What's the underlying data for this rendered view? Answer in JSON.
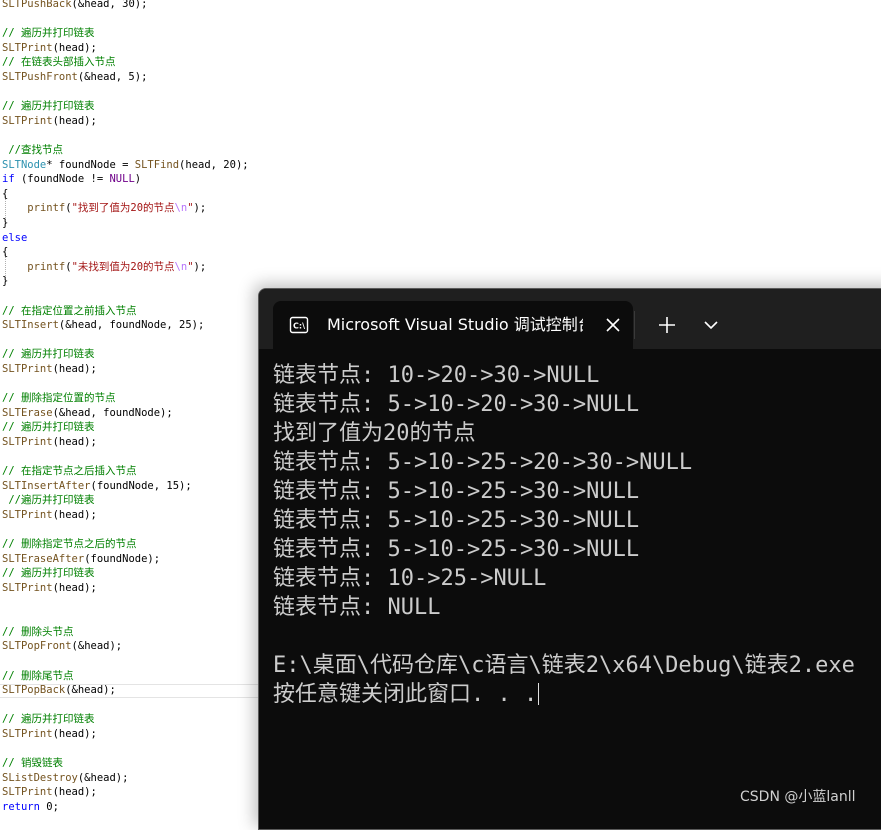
{
  "editor": {
    "lines": [
      [
        [
          "tok-func",
          "SLTPushBack"
        ],
        [
          "",
          "(&head, 30);"
        ]
      ],
      [],
      [
        [
          "tok-comment",
          "// 遍历并打印链表"
        ]
      ],
      [
        [
          "tok-func",
          "SLTPrint"
        ],
        [
          "",
          "(head);"
        ]
      ],
      [
        [
          "tok-comment",
          "// 在链表头部插入节点"
        ]
      ],
      [
        [
          "tok-func",
          "SLTPushFront"
        ],
        [
          "",
          "(&head, 5);"
        ]
      ],
      [],
      [
        [
          "tok-comment",
          "// 遍历并打印链表"
        ]
      ],
      [
        [
          "tok-func",
          "SLTPrint"
        ],
        [
          "",
          "(head);"
        ]
      ],
      [],
      [
        [
          "tok-comment",
          " //查找节点"
        ]
      ],
      [
        [
          "tok-type",
          "SLTNode"
        ],
        [
          "",
          "* foundNode = "
        ],
        [
          "tok-func",
          "SLTFind"
        ],
        [
          "",
          "(head, 20);"
        ]
      ],
      [
        [
          "tok-keyword",
          "if"
        ],
        [
          "",
          " (foundNode != "
        ],
        [
          "tok-macro",
          "NULL"
        ],
        [
          "",
          ")"
        ]
      ],
      [
        [
          "",
          "{"
        ]
      ],
      [
        [
          "",
          "    "
        ],
        [
          "tok-func",
          "printf"
        ],
        [
          "",
          "("
        ],
        [
          "tok-string",
          "\"找到了值为20的节点"
        ],
        [
          "tok-escape",
          "\\n"
        ],
        [
          "tok-string",
          "\""
        ],
        [
          "",
          ");"
        ]
      ],
      [
        [
          "",
          "}"
        ]
      ],
      [
        [
          "tok-keyword",
          "else"
        ]
      ],
      [
        [
          "",
          "{"
        ]
      ],
      [
        [
          "",
          "    "
        ],
        [
          "tok-func",
          "printf"
        ],
        [
          "",
          "("
        ],
        [
          "tok-string",
          "\"未找到值为20的节点"
        ],
        [
          "tok-escape",
          "\\n"
        ],
        [
          "tok-string",
          "\""
        ],
        [
          "",
          ");"
        ]
      ],
      [
        [
          "",
          "}"
        ]
      ],
      [],
      [
        [
          "tok-comment",
          "// 在指定位置之前插入节点"
        ]
      ],
      [
        [
          "tok-func",
          "SLTInsert"
        ],
        [
          "",
          "(&head, foundNode, 25);"
        ]
      ],
      [],
      [
        [
          "tok-comment",
          "// 遍历并打印链表"
        ]
      ],
      [
        [
          "tok-func",
          "SLTPrint"
        ],
        [
          "",
          "(head);"
        ]
      ],
      [],
      [
        [
          "tok-comment",
          "// 删除指定位置的节点"
        ]
      ],
      [
        [
          "tok-func",
          "SLTErase"
        ],
        [
          "",
          "(&head, foundNode);"
        ]
      ],
      [
        [
          "tok-comment",
          "// 遍历并打印链表"
        ]
      ],
      [
        [
          "tok-func",
          "SLTPrint"
        ],
        [
          "",
          "(head);"
        ]
      ],
      [],
      [
        [
          "tok-comment",
          "// 在指定节点之后插入节点"
        ]
      ],
      [
        [
          "tok-func",
          "SLTInsertAfter"
        ],
        [
          "",
          "(foundNode, 15);"
        ]
      ],
      [
        [
          "tok-comment",
          " //遍历并打印链表"
        ]
      ],
      [
        [
          "tok-func",
          "SLTPrint"
        ],
        [
          "",
          "(head);"
        ]
      ],
      [],
      [
        [
          "tok-comment",
          "// 删除指定节点之后的节点"
        ]
      ],
      [
        [
          "tok-func",
          "SLTEraseAfter"
        ],
        [
          "",
          "(foundNode);"
        ]
      ],
      [
        [
          "tok-comment",
          "// 遍历并打印链表"
        ]
      ],
      [
        [
          "tok-func",
          "SLTPrint"
        ],
        [
          "",
          "(head);"
        ]
      ],
      [],
      [],
      [
        [
          "tok-comment",
          "// 删除头节点"
        ]
      ],
      [
        [
          "tok-func",
          "SLTPopFront"
        ],
        [
          "",
          "(&head);"
        ]
      ],
      [],
      [
        [
          "tok-comment",
          "// 删除尾节点"
        ]
      ],
      [
        [
          "tok-func",
          "SLTPopBack"
        ],
        [
          "",
          "(&head);"
        ]
      ],
      [],
      [
        [
          "tok-comment",
          "// 遍历并打印链表"
        ]
      ],
      [
        [
          "tok-func",
          "SLTPrint"
        ],
        [
          "",
          "(head);"
        ]
      ],
      [],
      [
        [
          "tok-comment",
          "// 销毁链表"
        ]
      ],
      [
        [
          "tok-func",
          "SListDestroy"
        ],
        [
          "",
          "(&head);"
        ]
      ],
      [
        [
          "tok-func",
          "SLTPrint"
        ],
        [
          "",
          "(head);"
        ]
      ],
      [
        [
          "tok-keyword",
          "return"
        ],
        [
          "",
          " 0;"
        ]
      ]
    ]
  },
  "console": {
    "tab_title": "Microsoft Visual Studio 调试控制台",
    "tab_icon": "terminal-icon",
    "close_icon": "close-icon",
    "new_tab_icon": "plus-icon",
    "dropdown_icon": "chevron-down-icon",
    "background": "#0c0c0c",
    "text_color": "#cccccc",
    "output": [
      "链表节点: 10->20->30->NULL",
      "链表节点: 5->10->20->30->NULL",
      "找到了值为20的节点",
      "链表节点: 5->10->25->20->30->NULL",
      "链表节点: 5->10->25->30->NULL",
      "链表节点: 5->10->25->30->NULL",
      "链表节点: 5->10->25->30->NULL",
      "链表节点: 10->25->NULL",
      "链表节点: NULL",
      "",
      "E:\\桌面\\代码仓库\\c语言\\链表2\\x64\\Debug\\链表2.exe",
      "按任意键关闭此窗口. . ."
    ]
  },
  "watermark": "CSDN @小蓝lanll"
}
